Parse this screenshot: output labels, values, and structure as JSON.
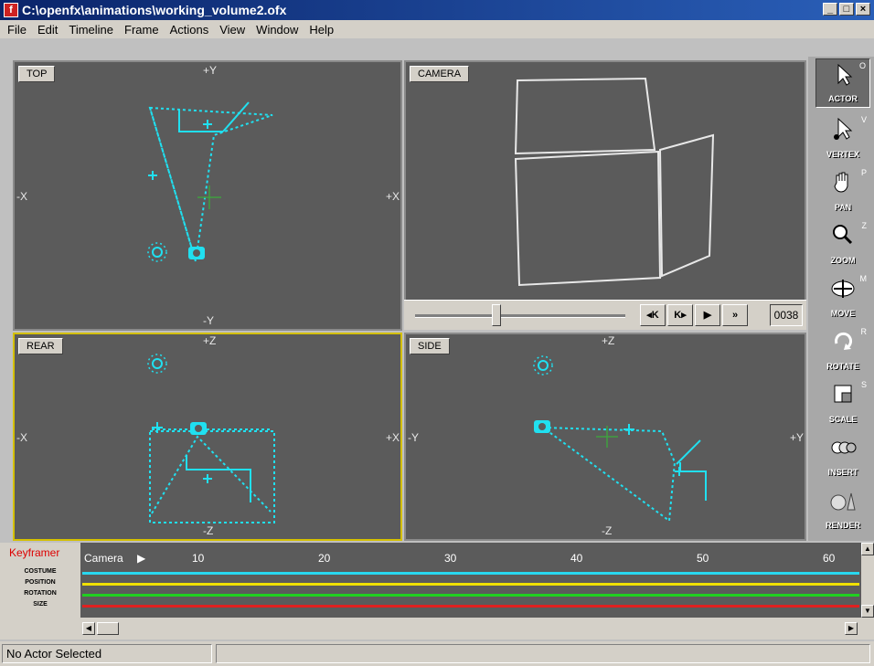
{
  "window": {
    "title": "C:\\openfx\\animations\\working_volume2.ofx",
    "icon_letter": "f",
    "min": "_",
    "max": "□",
    "close": "×"
  },
  "menu": [
    "File",
    "Edit",
    "Timeline",
    "Frame",
    "Actions",
    "View",
    "Window",
    "Help"
  ],
  "viewports": {
    "top": {
      "label": "TOP",
      "axis_top": "+Y",
      "axis_bottom": "-Y",
      "axis_left": "-X",
      "axis_right": "+X"
    },
    "camera": {
      "label": "CAMERA"
    },
    "rear": {
      "label": "REAR",
      "axis_top": "+Z",
      "axis_bottom": "-Z",
      "axis_left": "-X",
      "axis_right": "+X"
    },
    "side": {
      "label": "SIDE",
      "axis_top": "+Z",
      "axis_bottom": "-Z",
      "axis_left": "-Y",
      "axis_right": "+Y"
    }
  },
  "playback": {
    "prev_key": "◂K",
    "next_key": "K▸",
    "play": "▶",
    "fast": "»",
    "frame": "0038",
    "slider_fraction": 0.38
  },
  "tools": [
    {
      "label": "ACTOR",
      "key": "O",
      "icon": "arrow-icon"
    },
    {
      "label": "VERTEX",
      "key": "V",
      "icon": "vertex-arrow-icon"
    },
    {
      "label": "PAN",
      "key": "P",
      "icon": "hand-icon"
    },
    {
      "label": "ZOOM",
      "key": "Z",
      "icon": "magnifier-icon"
    },
    {
      "label": "MOVE",
      "key": "M",
      "icon": "move-icon"
    },
    {
      "label": "ROTATE",
      "key": "R",
      "icon": "rotate-icon"
    },
    {
      "label": "SCALE",
      "key": "S",
      "icon": "scale-icon"
    },
    {
      "label": "INSERT",
      "key": "",
      "icon": "insert-icon"
    },
    {
      "label": "RENDER",
      "key": "",
      "icon": "render-icon"
    }
  ],
  "keyframer": {
    "title": "Keyframer",
    "rows": [
      "COSTUME",
      "POSITION",
      "ROTATION",
      "SIZE"
    ],
    "actor": "Camera",
    "ruler": [
      "10",
      "20",
      "30",
      "40",
      "50",
      "60"
    ],
    "track_colors": [
      "#28d8f0",
      "#f0e000",
      "#20d020",
      "#e02020"
    ]
  },
  "status": {
    "text": "No Actor Selected"
  }
}
